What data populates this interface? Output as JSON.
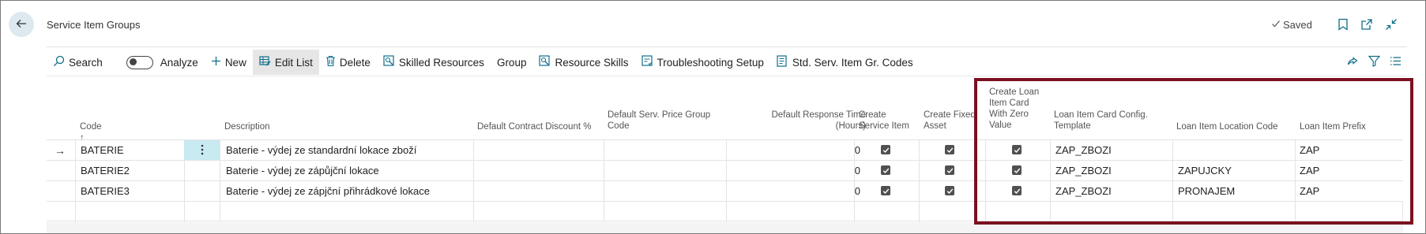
{
  "header": {
    "title": "Service Item Groups",
    "saved_label": "Saved"
  },
  "actions": {
    "search": "Search",
    "analyze": "Analyze",
    "new": "New",
    "edit_list": "Edit List",
    "delete": "Delete",
    "skilled_resources": "Skilled Resources",
    "group": "Group",
    "resource_skills": "Resource Skills",
    "troubleshooting_setup": "Troubleshooting Setup",
    "std_codes": "Std. Serv. Item Gr. Codes"
  },
  "columns": {
    "code": "Code ↑",
    "description": "Description",
    "discount": "Default Contract Discount %",
    "price_group": "Default Serv. Price Group Code",
    "response_time": "Default Response Time (Hours)",
    "create_service_item": "Create Service Item",
    "create_fixed_asset": "Create Fixed Asset",
    "create_loan_card": "Create Loan Item Card With Zero Value",
    "config_template": "Loan Item Card Config. Template",
    "location_code": "Loan Item Location Code",
    "prefix": "Loan Item Prefix"
  },
  "rows": [
    {
      "code": "BATERIE",
      "description": "Baterie - výdej ze standardní lokace zboží",
      "discount": "",
      "price_group": "",
      "response_time": "0",
      "create_service_item": true,
      "create_fixed_asset": true,
      "create_loan_card": true,
      "config_template": "ZAP_ZBOZI",
      "location_code": "",
      "prefix": "ZAP"
    },
    {
      "code": "BATERIE2",
      "description": "Baterie - výdej ze zápůjční lokace",
      "discount": "",
      "price_group": "",
      "response_time": "0",
      "create_service_item": true,
      "create_fixed_asset": true,
      "create_loan_card": true,
      "config_template": "ZAP_ZBOZI",
      "location_code": "ZAPUJCKY",
      "prefix": "ZAP"
    },
    {
      "code": "BATERIE3",
      "description": "Baterie - výdej ze zápjční přihrádkové lokace",
      "discount": "",
      "price_group": "",
      "response_time": "0",
      "create_service_item": true,
      "create_fixed_asset": true,
      "create_loan_card": true,
      "config_template": "ZAP_ZBOZI",
      "location_code": "PRONAJEM",
      "prefix": "ZAP"
    }
  ],
  "colors": {
    "accent": "#0f6f8a",
    "highlight_border": "#7b1020",
    "selected_cell": "#c8eaf1",
    "back_button": "#dde9ef"
  }
}
